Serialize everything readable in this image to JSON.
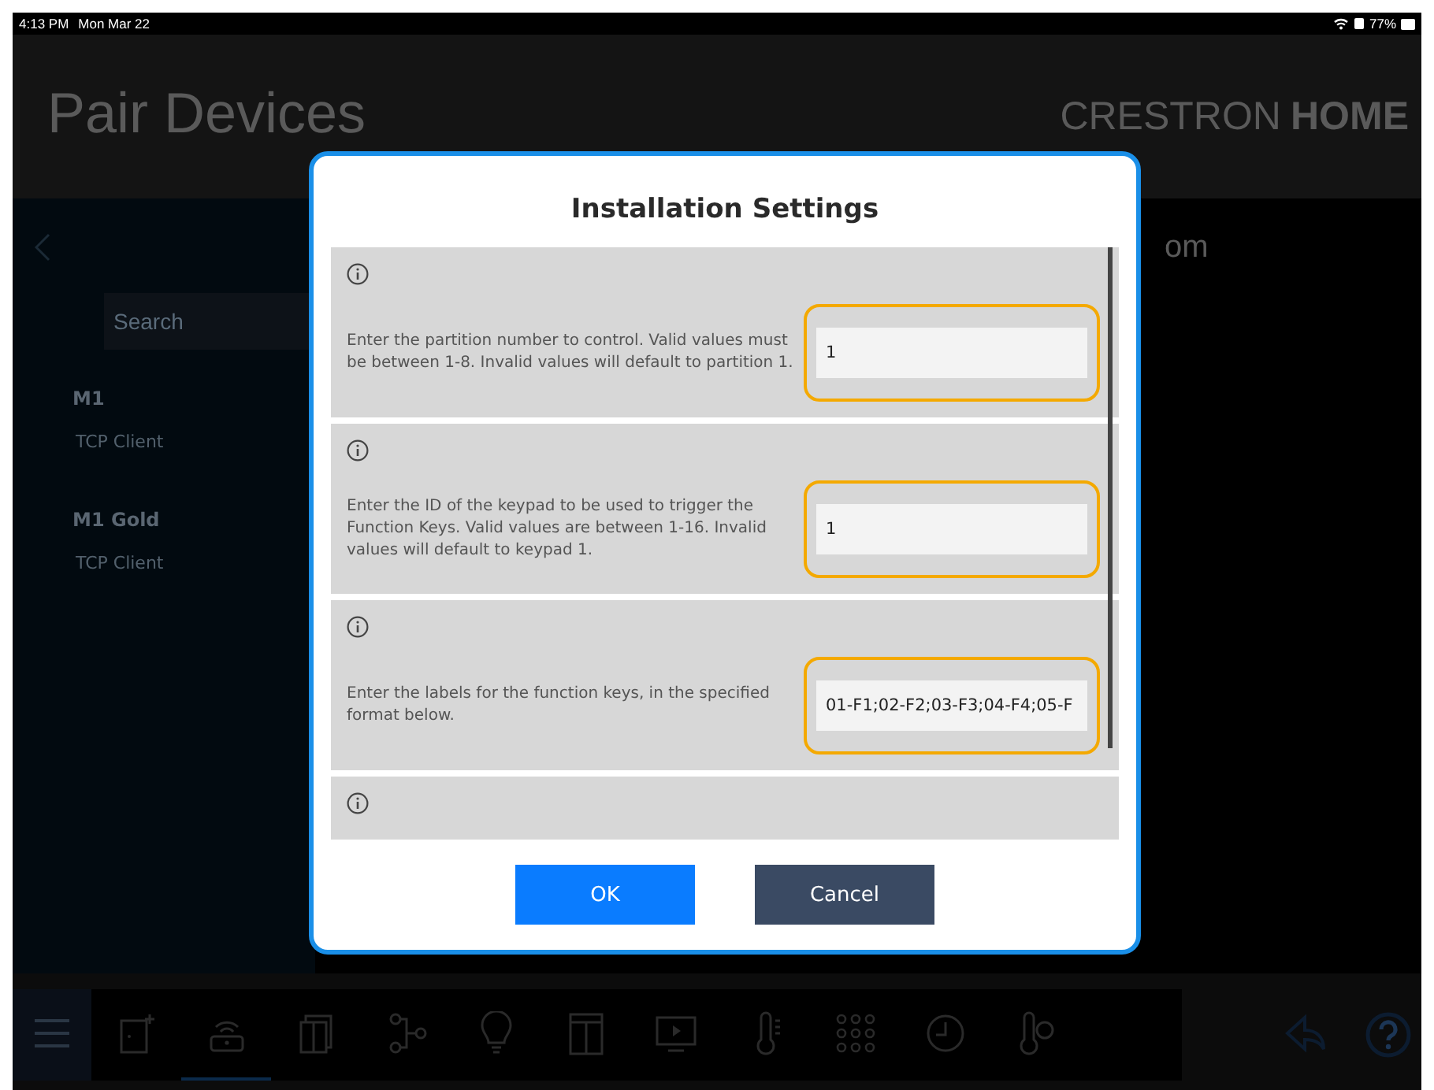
{
  "status_bar": {
    "time": "4:13 PM",
    "date": "Mon Mar 22",
    "battery": "77%"
  },
  "header": {
    "title": "Pair Devices",
    "brand_light": "CRESTRON",
    "brand_bold": "HOME"
  },
  "sidebar": {
    "search": {
      "placeholder": "Search"
    },
    "devices": [
      {
        "name": "M1",
        "type": "TCP Client"
      },
      {
        "name": "M1 Gold",
        "type": "TCP Client"
      }
    ]
  },
  "content_title_fragment": "om",
  "dialog": {
    "title": "Installation Settings",
    "settings": [
      {
        "description": "Enter the partition number to control. Valid values must be between 1-8. Invalid values will default to partition 1.",
        "value": "1",
        "kind": "input"
      },
      {
        "description": "Enter the ID of the keypad to be used to trigger the Function Keys. Valid values are between 1-16. Invalid values will default to keypad 1.",
        "value": "1",
        "kind": "input"
      },
      {
        "description": "Enter the labels for the function keys, in the specified format below.",
        "value": "01-F1;02-F2;03-F3;04-F4;05-F",
        "kind": "input"
      },
      {
        "kind": "cut_off"
      }
    ],
    "buttons": [
      {
        "label": "OK",
        "kind": "primary"
      },
      {
        "label": "Cancel",
        "kind": "secondary"
      }
    ]
  },
  "toolbar": [
    {
      "kind": "menu",
      "selected": false
    },
    {
      "kind": "door",
      "selected": false
    },
    {
      "kind": "router",
      "selected": true
    },
    {
      "kind": "shades",
      "selected": false
    },
    {
      "kind": "nodes",
      "selected": false
    },
    {
      "kind": "bulb",
      "selected": false
    },
    {
      "kind": "panel",
      "selected": false
    },
    {
      "kind": "tv",
      "selected": false
    },
    {
      "kind": "thermometer",
      "selected": false
    },
    {
      "kind": "keypad",
      "selected": false
    },
    {
      "kind": "clock",
      "selected": false
    },
    {
      "kind": "thermo-clock",
      "selected": false
    }
  ],
  "corner_actions": [
    {
      "kind": "reply"
    },
    {
      "kind": "help"
    }
  ]
}
